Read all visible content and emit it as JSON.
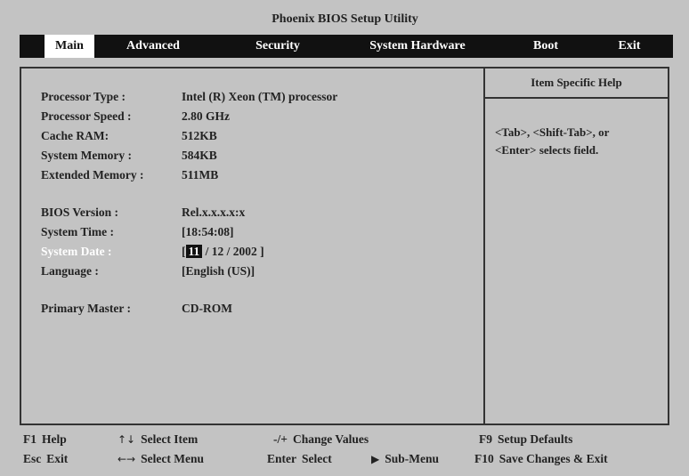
{
  "title": "Phoenix BIOS Setup Utility",
  "menu": {
    "items": [
      "Main",
      "Advanced",
      "Security",
      "System Hardware",
      "Boot",
      "Exit"
    ],
    "active": "Main"
  },
  "main": {
    "processor_type": {
      "label": "Processor Type :",
      "value": "Intel (R) Xeon (TM) processor"
    },
    "processor_speed": {
      "label": "Processor Speed :",
      "value": "2.80 GHz"
    },
    "cache_ram": {
      "label": "Cache RAM:",
      "value": "512KB"
    },
    "system_memory": {
      "label": "System Memory :",
      "value": "584KB"
    },
    "extended_memory": {
      "label": "Extended Memory :",
      "value": "511MB"
    },
    "bios_version": {
      "label": "BIOS Version :",
      "value": "Rel.x.x.x.x:x"
    },
    "system_time": {
      "label": "System Time :",
      "value": "[18:54:08]"
    },
    "system_date": {
      "label": "System Date :",
      "open": "[",
      "month": "11",
      "rest": "/ 12 / 2002 ]"
    },
    "language": {
      "label": "Language :",
      "value": "[English (US)]"
    },
    "primary_master": {
      "label": "Primary Master :",
      "value": "CD-ROM"
    }
  },
  "help": {
    "title": "Item Specific Help",
    "line1": "<Tab>, <Shift-Tab>, or",
    "line2": "<Enter> selects field."
  },
  "footer": {
    "f1": {
      "key": "F1",
      "action": "Help"
    },
    "esc": {
      "key": "Esc",
      "action": "Exit"
    },
    "updown": {
      "key": "↑↓",
      "action": "Select Item"
    },
    "leftright": {
      "key": "←→",
      "action": "Select Menu"
    },
    "plusminus": {
      "key": "-/+",
      "action": "Change Values"
    },
    "enter": {
      "key": "Enter",
      "action": "Select"
    },
    "submenu": {
      "key": "▶",
      "action": "Sub-Menu"
    },
    "f9": {
      "key": "F9",
      "action": "Setup Defaults"
    },
    "f10": {
      "key": "F10",
      "action": "Save Changes & Exit"
    }
  }
}
